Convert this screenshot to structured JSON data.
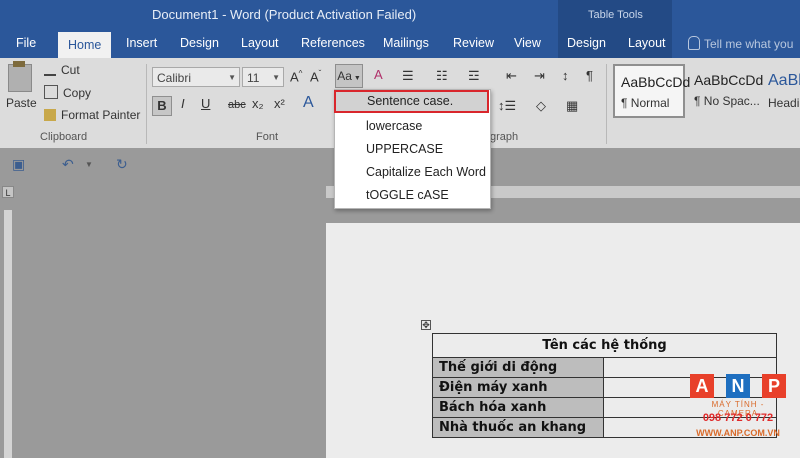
{
  "window": {
    "title": "Document1 - Word (Product Activation Failed)",
    "context_title": "Table Tools",
    "tell_me": "Tell me what you"
  },
  "tabs": [
    {
      "label": "File"
    },
    {
      "label": "Home"
    },
    {
      "label": "Insert"
    },
    {
      "label": "Design"
    },
    {
      "label": "Layout"
    },
    {
      "label": "References"
    },
    {
      "label": "Mailings"
    },
    {
      "label": "Review"
    },
    {
      "label": "View"
    },
    {
      "label": "Design"
    },
    {
      "label": "Layout"
    }
  ],
  "clipboard": {
    "paste": "Paste",
    "cut": "Cut",
    "copy": "Copy",
    "format_painter": "Format Painter",
    "group_label": "Clipboard"
  },
  "font": {
    "name": "Calibri",
    "size": "11",
    "change_case": "Aa",
    "group_label": "Font",
    "bold": "B",
    "italic": "I",
    "underline": "U",
    "strike": "abc",
    "subscript": "x₂",
    "superscript": "x²"
  },
  "paragraph": {
    "group_label_fragment": "graph"
  },
  "styles": [
    {
      "sample": "AaBbCcDd",
      "name": "¶ Normal"
    },
    {
      "sample": "AaBbCcDd",
      "name": "¶ No Spac..."
    },
    {
      "sample": "AaBbC",
      "name": "Headi"
    }
  ],
  "change_case_menu": [
    {
      "label": "Sentence case.",
      "selected": true
    },
    {
      "label": "lowercase",
      "selected": false
    },
    {
      "label": "UPPERCASE",
      "selected": false
    },
    {
      "label": "Capitalize Each Word",
      "selected": false
    },
    {
      "label": "tOGGLE cASE",
      "selected": false
    }
  ],
  "document_table": {
    "header": "Tên các hệ thống",
    "rows": [
      "Thế giới di động",
      "Điện máy xanh",
      "Bách hóa xanh",
      "Nhà thuốc an khang"
    ]
  },
  "watermark": {
    "letters": [
      "A",
      "N",
      "P"
    ],
    "subtitle": "MÁY TÍNH - CAMERA",
    "phone": "098 772 0 772",
    "site": "WWW.ANP.COM.VN"
  },
  "colors": {
    "title_bar": "#2b579a",
    "selection_border": "#d9262c",
    "wm_a": "#e8402a",
    "wm_n": "#1e6fc0",
    "wm_p": "#e8402a"
  }
}
